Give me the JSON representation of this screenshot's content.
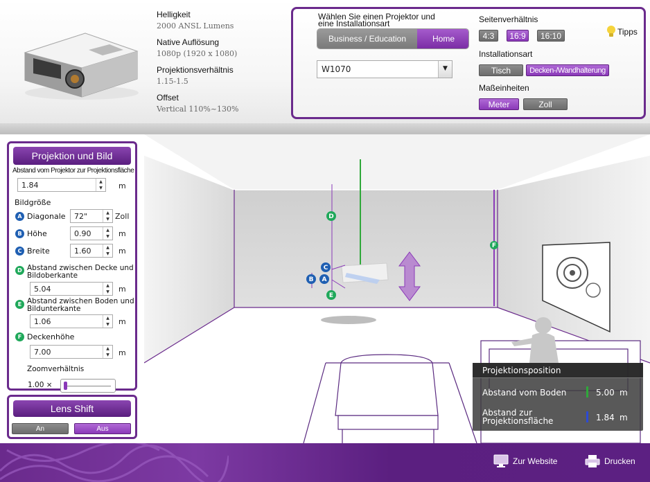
{
  "specs": {
    "brightness_label": "Helligkeit",
    "brightness_value": "2000 ANSL Lumens",
    "resolution_label": "Native Auflösung",
    "resolution_value": "1080p (1920 x 1080)",
    "ratio_label": "Projektionsverhältnis",
    "ratio_value": "1.15-1.5",
    "offset_label": "Offset",
    "offset_value": "Vertical 110%~130%"
  },
  "config": {
    "select_title_line1": "Wählen Sie einen Projektor und",
    "select_title_line2": "eine Installationsart",
    "segment_business": "Business / Education",
    "segment_home": "Home",
    "model_value": "W1070",
    "aspect_title": "Seitenverhältnis",
    "aspect_options": [
      "4:3",
      "16:9",
      "16:10"
    ],
    "install_title": "Installationsart",
    "install_options": [
      "Tisch",
      "Decken-/Wandhalterung"
    ],
    "units_title": "Maßeinheiten",
    "unit_options": [
      "Meter",
      "Zoll"
    ],
    "tips_label": "Tipps"
  },
  "projection": {
    "title": "Projektion und Bild",
    "distance_label": "Abstand vom Projektor zur  Projektionsfläche",
    "distance_value": "1.84",
    "distance_unit": "m",
    "size_label": "Bildgröße",
    "diag_label": "Diagonale",
    "diag_value": "72\"",
    "diag_unit": "Zoll",
    "height_label": "Höhe",
    "height_value": "0.90",
    "height_unit": "m",
    "width_label": "Breite",
    "width_value": "1.60",
    "width_unit": "m",
    "ceiling_top_label_1": "Abstand zwischen Decke und",
    "ceiling_top_label_2": "Bildoberkante",
    "ceiling_top_value": "5.04",
    "ceiling_top_unit": "m",
    "floor_bottom_label_1": "Abstand zwischen Boden und",
    "floor_bottom_label_2": "Bildunterkante",
    "floor_bottom_value": "1.06",
    "floor_bottom_unit": "m",
    "ceiling_h_label": "Deckenhöhe",
    "ceiling_h_value": "7.00",
    "ceiling_h_unit": "m",
    "zoom_label": "Zoomverhältnis",
    "zoom_value": "1.00 ×",
    "zoom_level": 0.0
  },
  "lens": {
    "title": "Lens Shift",
    "on": "An",
    "off": "Aus"
  },
  "markers": {
    "A": "A",
    "B": "B",
    "C": "C",
    "D": "D",
    "E": "E",
    "F": "F"
  },
  "position": {
    "title": "Projektionsposition",
    "floor_label": "Abstand vom Boden",
    "floor_value": "5.00",
    "floor_unit": "m",
    "screen_label_1": "Abstand zur",
    "screen_label_2": "Projektionsfläche",
    "screen_value": "1.84",
    "screen_unit": "m"
  },
  "footer": {
    "website": "Zur Website",
    "print": "Drucken"
  },
  "colors": {
    "accent": "#6a2a8c",
    "marker_blue": "#1f5fb2",
    "marker_green": "#1fa85a"
  }
}
